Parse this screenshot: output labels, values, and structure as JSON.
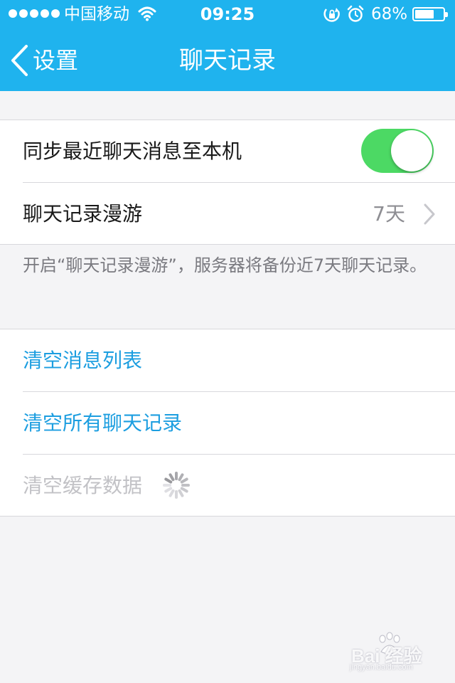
{
  "status_bar": {
    "carrier": "中国移动",
    "time": "09:25",
    "battery_percent": "68%",
    "battery_level": 0.68,
    "icons": [
      "signal-dots",
      "wifi-icon",
      "orientation-lock-icon",
      "alarm-icon",
      "battery-icon"
    ]
  },
  "nav": {
    "back_label": "设置",
    "title": "聊天记录",
    "back_icon": "chevron-left-icon"
  },
  "settings": {
    "sync_label": "同步最近聊天消息至本机",
    "sync_enabled": true,
    "roaming_label": "聊天记录漫游",
    "roaming_value": "7天",
    "footnote": "开启“聊天记录漫游”，服务器将备份近7天聊天记录。"
  },
  "actions": {
    "clear_message_list": "清空消息列表",
    "clear_all_history": "清空所有聊天记录",
    "clear_cache": "清空缓存数据"
  },
  "watermark": {
    "brand": "Bai  经验",
    "url": "jingyan.baidu.com"
  },
  "colors": {
    "header": "#1fb3ee",
    "toggle_on": "#4cd964",
    "action_text": "#1c9ee0",
    "disabled_text": "#c2c2c6"
  }
}
